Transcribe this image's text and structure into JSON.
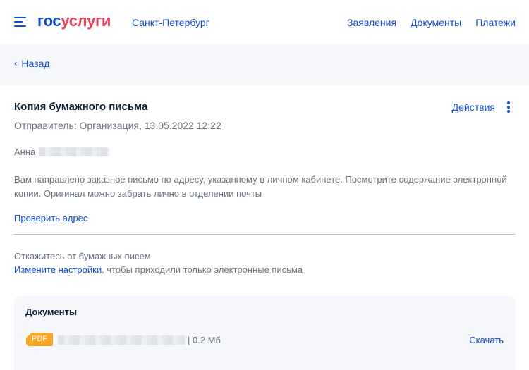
{
  "header": {
    "logo_part1": "гос",
    "logo_part2": "услуги",
    "city": "Санкт-Петербург",
    "nav": [
      "Заявления",
      "Документы",
      "Платежи"
    ]
  },
  "back": {
    "label": "Назад"
  },
  "letter": {
    "title": "Копия бумажного письма",
    "actions_label": "Действия",
    "sender": "Отправитель: Организация, 13.05.2022 12:22",
    "greeting": "Анна",
    "message": "Вам направлено заказное письмо по адресу, указанному в личном кабинете. Посмотрите содержание электронной копии. Оригинал можно забрать лично в отделении почты",
    "check_address": "Проверить адрес"
  },
  "opt_out": {
    "title": "Откажитесь от бумажных писем",
    "link": "Измените настройки",
    "rest": ", чтобы приходили только электронные письма"
  },
  "documents": {
    "title": "Документы",
    "file_type": "PDF",
    "file_size": "| 0.2 Мб",
    "download_label": "Скачать"
  },
  "colors": {
    "primary": "#0d4cd3",
    "brand_red": "#ee3f58",
    "pdf_badge": "#f5a623",
    "muted_text": "#66727f",
    "panel_bg": "#f5f7fa"
  }
}
